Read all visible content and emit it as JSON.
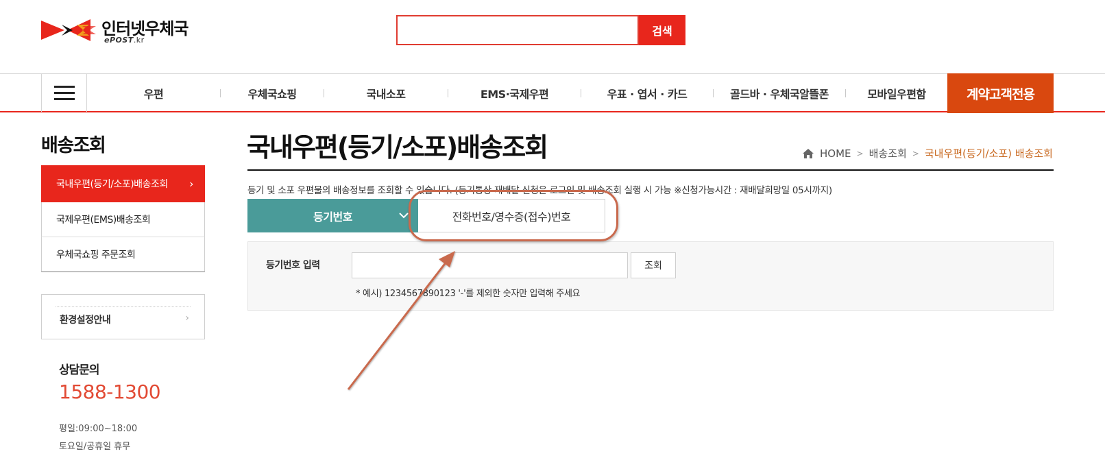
{
  "header": {
    "logo_title": "인터넷우체국",
    "logo_sub_main": "ePOST",
    "logo_sub_domain": ".kr",
    "search_value": "",
    "search_button": "검색"
  },
  "nav": {
    "menu_icon": "hamburger-icon",
    "items": [
      "우편",
      "우체국쇼핑",
      "국내소포",
      "EMS·국제우편",
      "우표 · 엽서 · 카드",
      "골드바 · 우체국알뜰폰",
      "모바일우편함"
    ],
    "cta": "계약고객전용"
  },
  "sidebar": {
    "title": "배송조회",
    "items": [
      {
        "label": "국내우편(등기/소포)배송조회",
        "active": true
      },
      {
        "label": "국제우편(EMS)배송조회",
        "active": false
      },
      {
        "label": "우체국쇼핑 주문조회",
        "active": false
      }
    ],
    "env_guide": "환경설정안내",
    "cs_title": "상담문의",
    "cs_phone": "1588-1300",
    "cs_hours": "평일:09:00~18:00",
    "cs_holiday": "토요일/공휴일 휴무"
  },
  "main": {
    "title": "국내우편(등기/소포)배송조회",
    "breadcrumb": [
      "HOME",
      "배송조회",
      "국내우편(등기/소포) 배송조회"
    ],
    "notice": "등기 및 소포 우편물의 배송정보를 조회할 수 있습니다. (등기통상 재배달 신청은 로그인 및 배송조회 실행 시 가능 ※신청가능시간 : 재배달희망일 05시까지)",
    "tabs": [
      {
        "label": "등기번호",
        "active": true
      },
      {
        "label": "전화번호/영수증(접수)번호",
        "active": false
      }
    ],
    "form": {
      "label": "등기번호 입력",
      "input_value": "",
      "button": "조회",
      "hint": "* 예시) 1234567890123 '-'를 제외한 숫자만 입력해 주세요"
    }
  },
  "colors": {
    "brand_red": "#e8261c",
    "cta_orange": "#d9480f",
    "tab_teal": "#4a9b99",
    "breadcrumb_current": "#c8681f",
    "phone_red": "#e24a34",
    "annotation": "#c96a4e"
  }
}
